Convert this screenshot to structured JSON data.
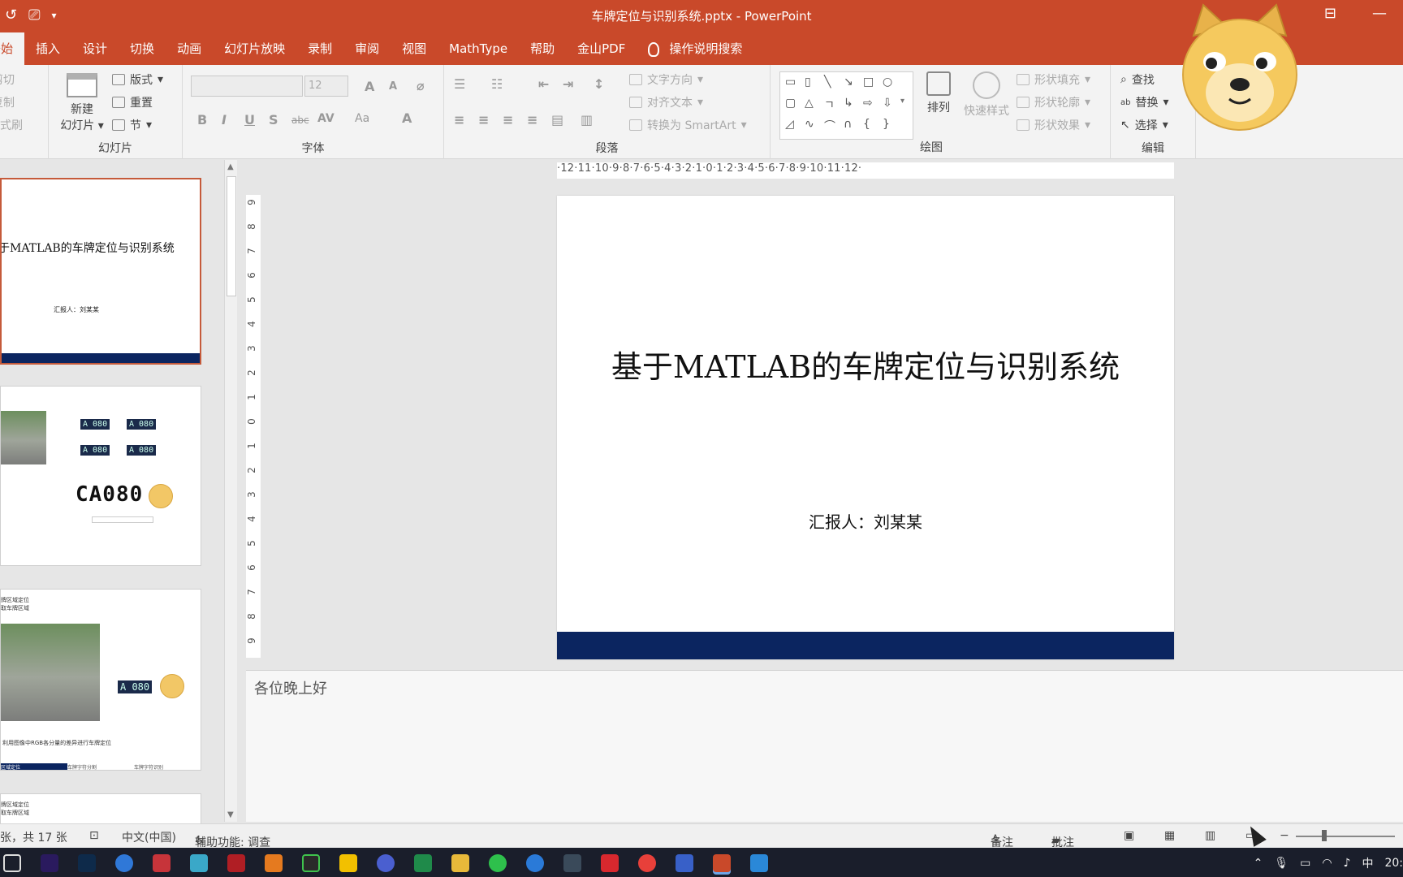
{
  "window": {
    "title": "车牌定位与识别系统.pptx - PowerPoint",
    "qat_icons": [
      "undo-icon",
      "presenter-icon",
      "customize-qat-icon"
    ],
    "controls": [
      "ribbon-display-icon",
      "minimize-icon"
    ]
  },
  "tabs": [
    {
      "label": "开始",
      "active": true
    },
    {
      "label": "插入"
    },
    {
      "label": "设计"
    },
    {
      "label": "切换"
    },
    {
      "label": "动画"
    },
    {
      "label": "幻灯片放映"
    },
    {
      "label": "录制"
    },
    {
      "label": "审阅"
    },
    {
      "label": "视图"
    },
    {
      "label": "MathType"
    },
    {
      "label": "帮助"
    },
    {
      "label": "金山PDF"
    },
    {
      "label": "操作说明搜索"
    }
  ],
  "ribbon": {
    "clipboard": {
      "cut": "剪切",
      "copy": "复制",
      "painter": "格式刷"
    },
    "slides": {
      "group_label": "幻灯片",
      "new_slide_line1": "新建",
      "new_slide_line2": "幻灯片",
      "layout": "版式",
      "reset": "重置",
      "section": "节"
    },
    "font": {
      "group_label": "字体",
      "font_name": "",
      "font_size": "12",
      "grow": "A",
      "shrink": "A",
      "bold": "B",
      "italic": "I",
      "underline": "U",
      "shadow": "S",
      "strike": "abc",
      "spacing": "AV",
      "case": "Aa",
      "color": "A"
    },
    "paragraph": {
      "group_label": "段落",
      "text_direction": "文字方向",
      "align_text": "对齐文本",
      "smartart": "转换为 SmartArt"
    },
    "drawing": {
      "group_label": "绘图",
      "arrange": "排列",
      "quick_styles": "快速样式",
      "shape_fill": "形状填充",
      "shape_outline": "形状轮廓",
      "shape_effects": "形状效果"
    },
    "editing": {
      "group_label": "编辑",
      "find": "查找",
      "replace": "替换",
      "select": "选择"
    }
  },
  "thumbnails": [
    {
      "selected": true,
      "title": "基于MATLAB的车牌定位与识别系统",
      "visible_title": "于MATLAB的车牌定位与识别系统",
      "subtitle": "汇报人：刘某某"
    },
    {
      "plates": [
        "A 080",
        "A 080",
        "A 080",
        "A 080"
      ],
      "big_plate": "CA080"
    },
    {
      "heading1": "牌区域定位",
      "heading2": "取车牌区域",
      "plate": "A 080",
      "caption": "利用图像中RGB各分量的差异进行车牌定位",
      "footer": [
        "区域定位",
        "车牌字符分割",
        "车牌字符识别"
      ]
    },
    {
      "heading1": "牌区域定位",
      "heading2": "取车牌区域"
    }
  ],
  "horizontal_ruler": "·12·11·10·9·8·7·6·5·4·3·2·1·0·1·2·3·4·5·6·7·8·9·10·11·12·",
  "vertical_ruler": [
    "9",
    "8",
    "7",
    "6",
    "5",
    "4",
    "3",
    "2",
    "1",
    "0",
    "1",
    "2",
    "3",
    "4",
    "5",
    "6",
    "7",
    "8",
    "9"
  ],
  "slide": {
    "title": "基于MATLAB的车牌定位与识别系统",
    "subtitle": "汇报人：刘某某",
    "bar_color": "#0b2560"
  },
  "notes": {
    "text": "各位晚上好"
  },
  "status": {
    "slide_counter": "张，共 17 张",
    "language": "中文(中国)",
    "accessibility": "辅助功能: 调查",
    "notes_button": "备注",
    "comments_button": "批注"
  },
  "taskbar": {
    "apps": [
      "task-view",
      "premiere",
      "photoshop",
      "browser",
      "app-red",
      "app-bird",
      "solidworks",
      "matlab-icon",
      "pycharm",
      "app-yellow",
      "app-blue",
      "excel-alt",
      "folder",
      "wechat",
      "app-blue-2",
      "app-dark",
      "youdao",
      "netease-music",
      "visio",
      "powerpoint",
      "app-wave"
    ],
    "active_app": "powerpoint",
    "tray": [
      "chevron-up-icon",
      "mic-icon",
      "battery-icon",
      "wifi-icon",
      "volume-icon"
    ],
    "ime": "中",
    "time": "20:"
  },
  "colors": {
    "accent": "#c9492a",
    "ribbon_bg": "#f3f3f3",
    "slide_bar": "#0b2560",
    "taskbar": "#1a1e2b"
  }
}
